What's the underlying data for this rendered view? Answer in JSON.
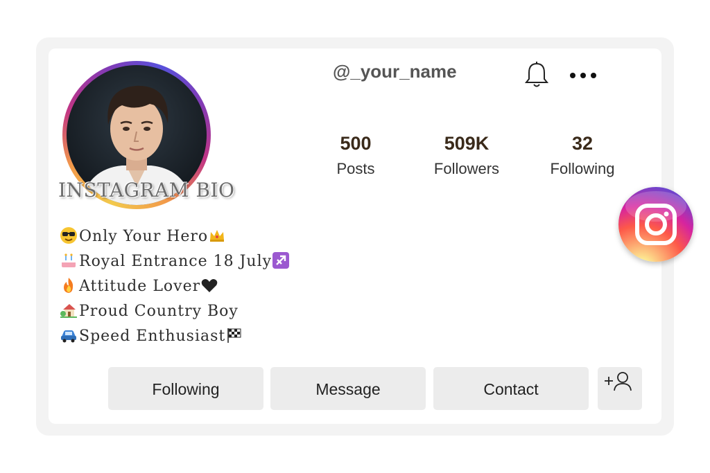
{
  "profile": {
    "username": "@_your_name",
    "watermark": "INSTAGRAM BIO"
  },
  "stats": [
    {
      "value": "500",
      "label": "Posts"
    },
    {
      "value": "509K",
      "label": "Followers"
    },
    {
      "value": "32",
      "label": "Following"
    }
  ],
  "bio": [
    {
      "emoji": "sunglasses-face",
      "text": "Only Your Hero",
      "trail_emoji": "crown"
    },
    {
      "emoji": "birthday-cake",
      "text": "Royal Entrance 18 July",
      "trail_emoji": "sagittarius"
    },
    {
      "emoji": "fire",
      "text": "Attitude Lover",
      "trail_emoji": "black-heart"
    },
    {
      "emoji": "house-with-garden",
      "text": "Proud Country Boy",
      "trail_emoji": ""
    },
    {
      "emoji": "car",
      "text": "Speed Enthusiast",
      "trail_emoji": "checkered-flag"
    }
  ],
  "buttons": {
    "following": "Following",
    "message": "Message",
    "contact": "Contact"
  },
  "icons": {
    "notifications": "bell-icon",
    "more": "more-options-icon",
    "add_user": "add-user-icon",
    "brand": "instagram-logo"
  },
  "colors": {
    "button_bg": "#ececec",
    "ring_start": "#833ab4",
    "ring_end": "#f2c94c"
  }
}
